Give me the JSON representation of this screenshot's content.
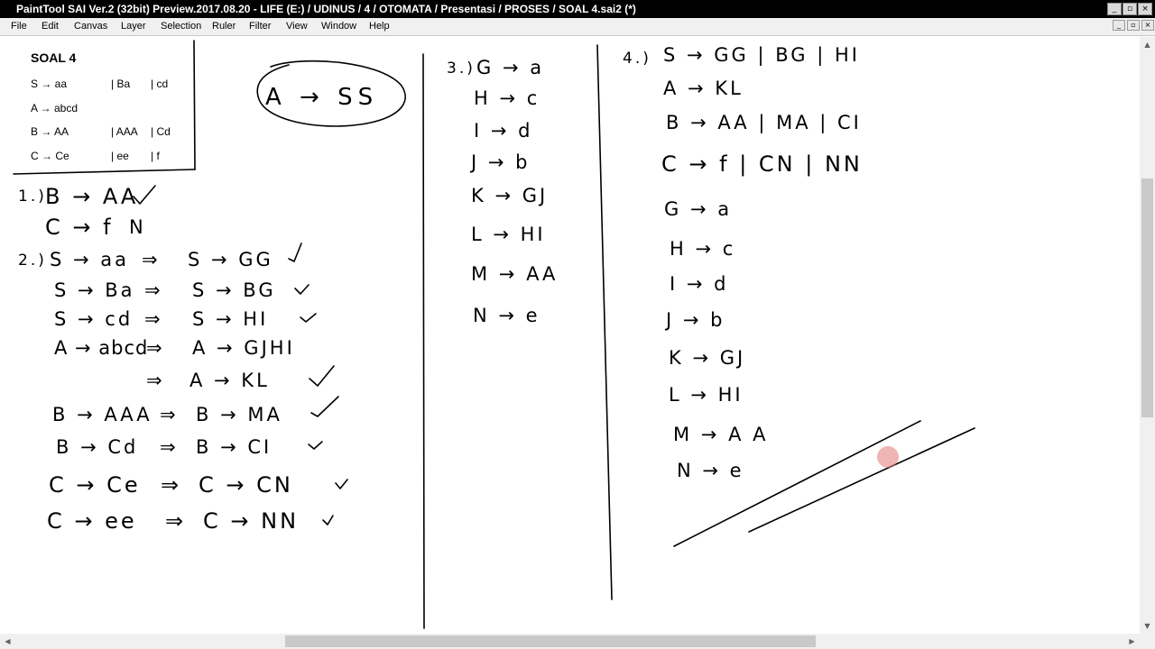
{
  "window": {
    "title": "PaintTool SAI Ver.2 (32bit) Preview.2017.08.20 - LIFE (E:) / UDINUS / 4 / OTOMATA / Presentasi / PROSES / SOAL 4.sai2 (*)",
    "controls": {
      "minimize": "_",
      "restore": "▫",
      "close": "×"
    }
  },
  "menu": {
    "items": [
      "File",
      "Edit",
      "Canvas",
      "Layer",
      "Selection",
      "Ruler",
      "Filter",
      "View",
      "Window",
      "Help"
    ]
  },
  "soal": {
    "title": "SOAL 4",
    "rows": [
      {
        "head": "S → aa",
        "alt1": "| Ba",
        "alt2": "| cd"
      },
      {
        "head": "A → abcd",
        "alt1": "",
        "alt2": ""
      },
      {
        "head": "B → AA",
        "alt1": "| AAA",
        "alt2": "| Cd"
      },
      {
        "head": "C → Ce",
        "alt1": "| ee",
        "alt2": "| f"
      }
    ]
  },
  "circled_note": "A → SS",
  "step1": {
    "label": "1.)",
    "lines": [
      "B → AA",
      "C → f"
    ]
  },
  "step2": {
    "label": "2.)",
    "lines": [
      {
        "left": "S → aa",
        "right": "S → GG"
      },
      {
        "left": "S → Ba",
        "right": "S → BG"
      },
      {
        "left": "S → cd",
        "right": "S → HI"
      },
      {
        "left": "A → abcd",
        "right": "A → GJHI"
      },
      {
        "left": "",
        "right": "A → KL"
      },
      {
        "left": "B → AAA",
        "right": "B → MA"
      },
      {
        "left": "B → Cd",
        "right": "B → CI"
      },
      {
        "left": "C → Ce",
        "right": "C → CN"
      },
      {
        "left": "C → ee",
        "right": "C → NN"
      }
    ],
    "implies": "⇒"
  },
  "step3": {
    "label": "3.)",
    "lines": [
      "G → a",
      "H → c",
      "I → d",
      "J → b",
      "K → GJ",
      "L → HI",
      "M → AA",
      "N → e"
    ]
  },
  "step4": {
    "label": "4.)",
    "lines": [
      "S → GG | BG | HI",
      "A → KL",
      "B → AA | MA | CI",
      "C → f | CN | NN",
      "G → a",
      "H → c",
      "I → d",
      "J → b",
      "K → GJ",
      "L → HI",
      "M → A A",
      "N → e"
    ]
  },
  "marks": {
    "check": "✓",
    "n_mark": "N"
  },
  "colors": {
    "titlebar": "#000000",
    "menubar": "#f0f0f0",
    "canvas": "#ffffff",
    "scroll_thumb": "#c9c9c9",
    "cursor": "#e17878"
  }
}
